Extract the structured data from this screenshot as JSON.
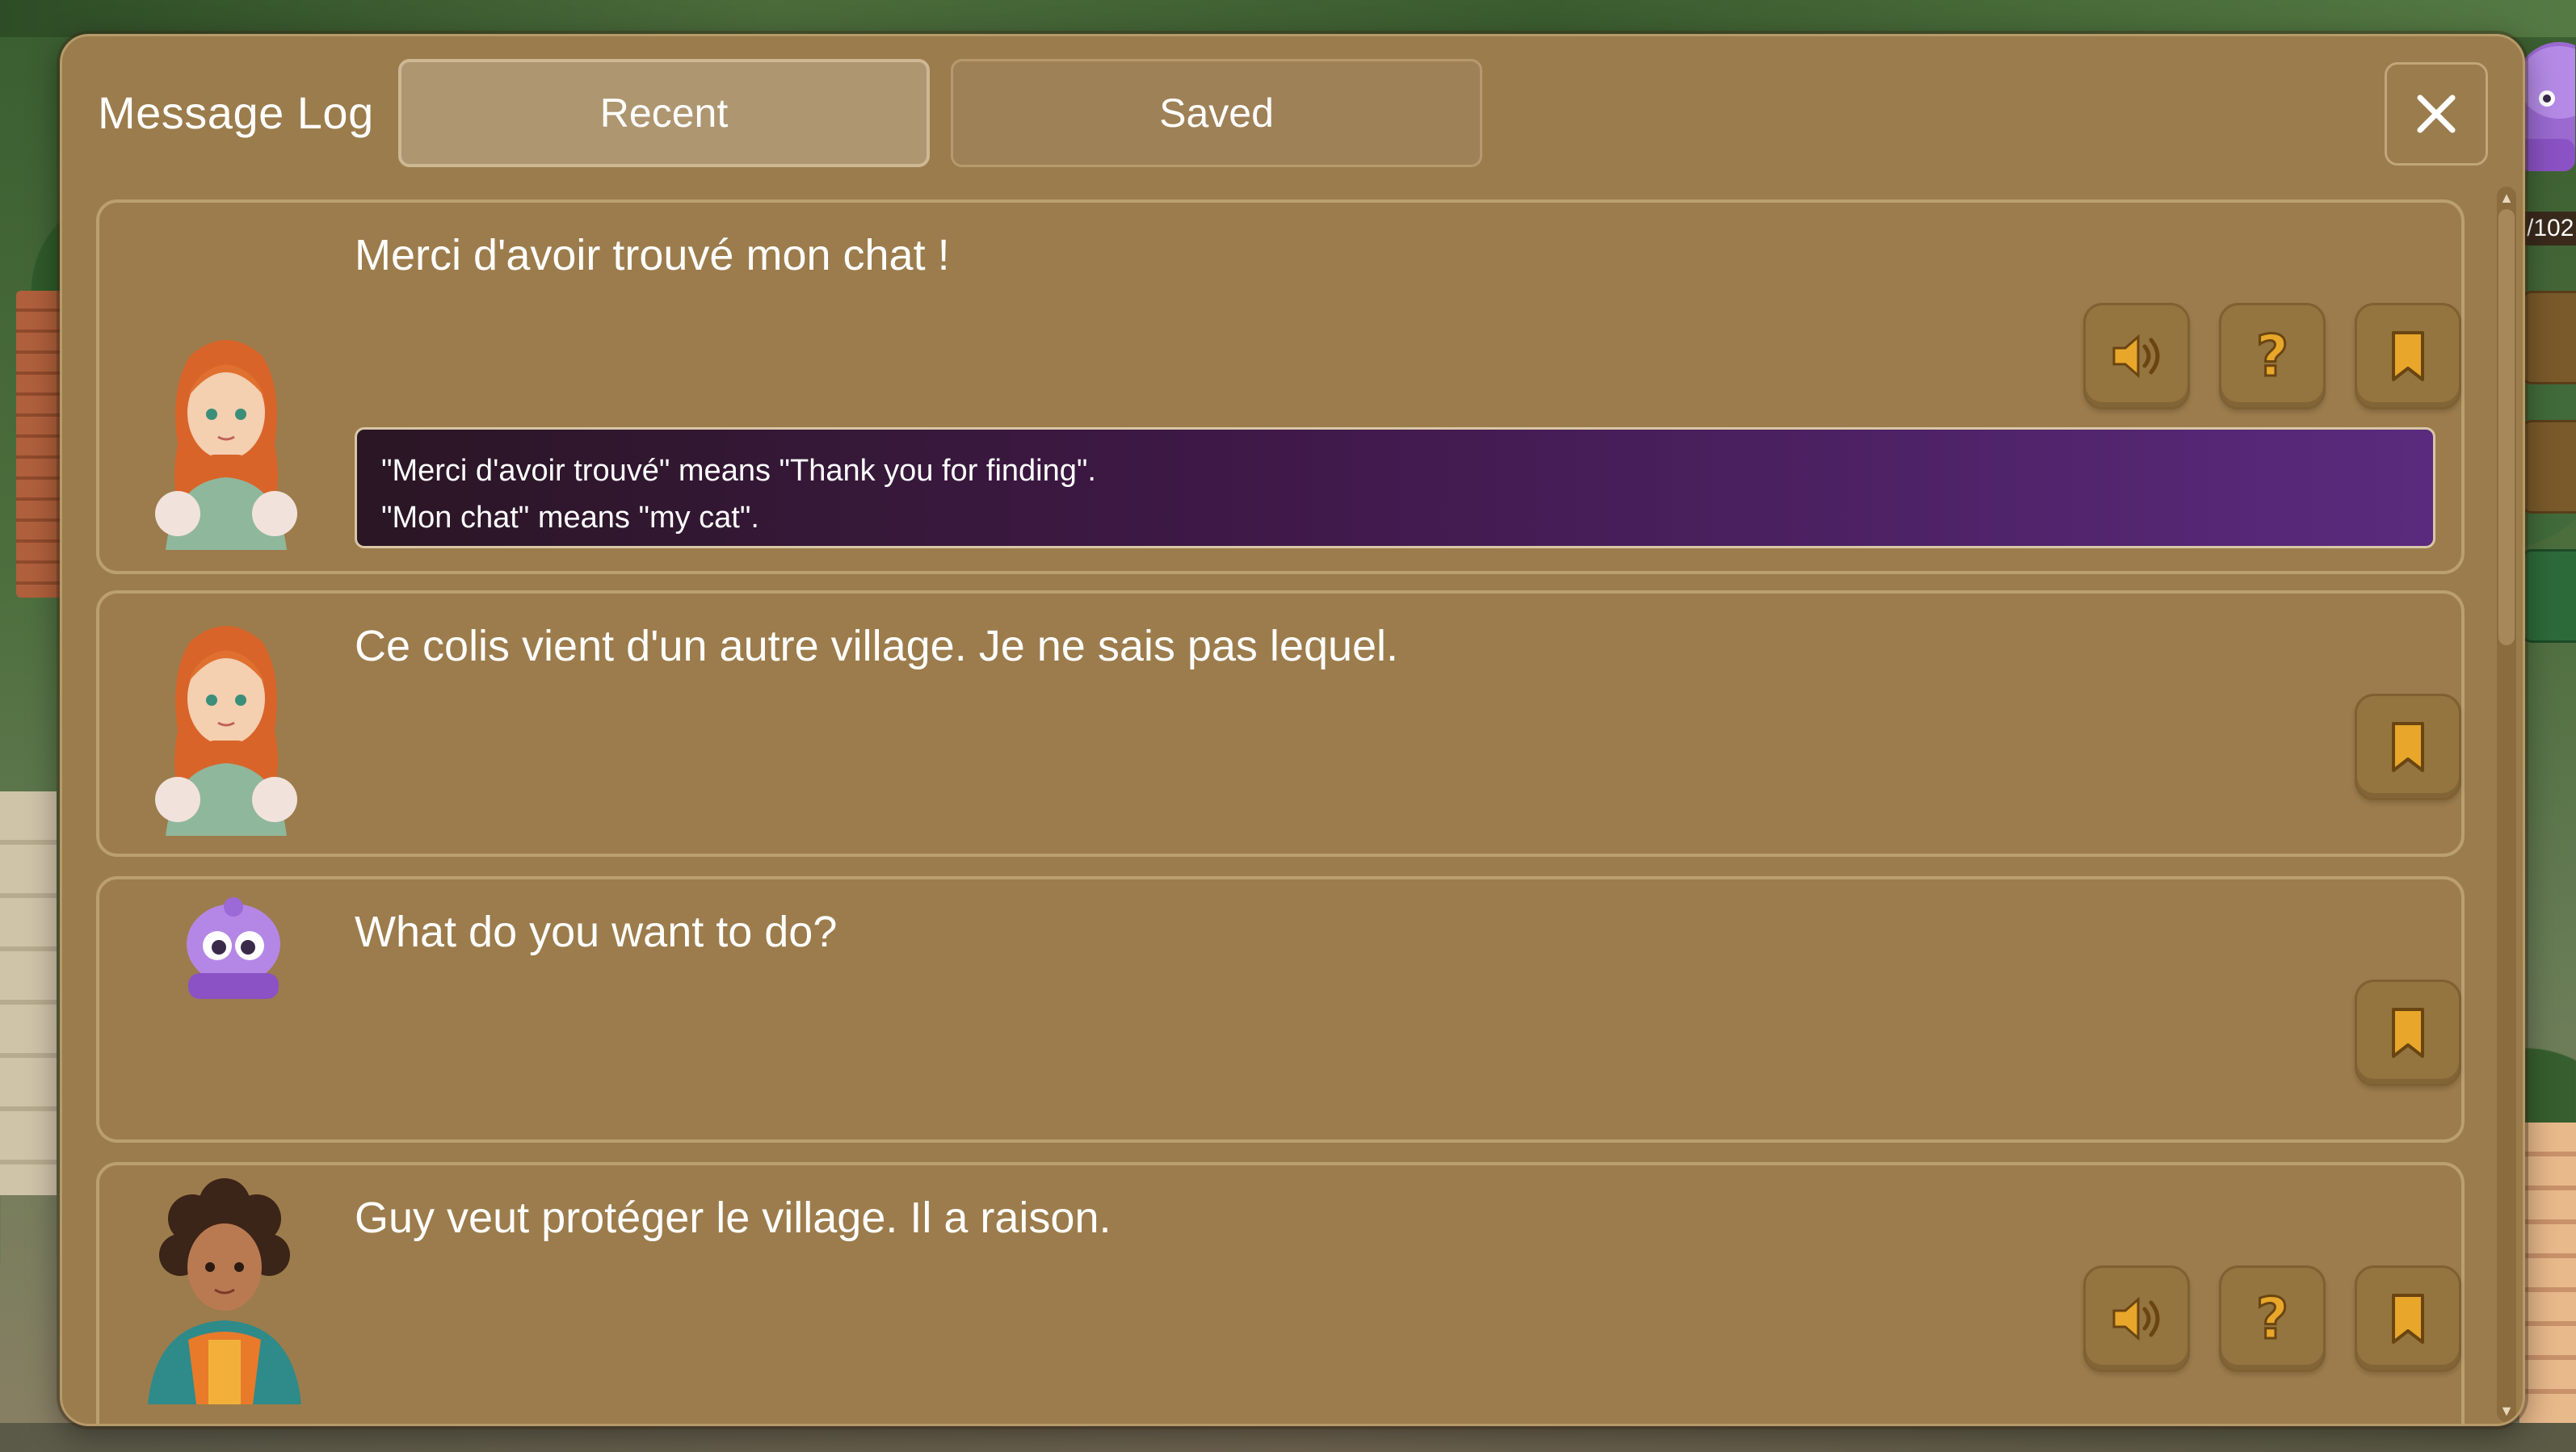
{
  "colors": {
    "panel": "#9b7c4c",
    "panel_border": "#bba06f",
    "button": "#94743f",
    "icon_gold": "#e8a72a",
    "translation_start": "#2a1624",
    "translation_end": "#5a2a7e"
  },
  "header": {
    "title": "Message Log",
    "tabs": [
      {
        "label": "Recent",
        "active": true
      },
      {
        "label": "Saved",
        "active": false
      }
    ],
    "close_icon": "close-icon"
  },
  "hud": {
    "counter": "/102"
  },
  "messages": [
    {
      "speaker_avatar": "redhead-girl-avatar",
      "text": "Merci d'avoir trouvé mon chat !",
      "actions": [
        "speaker-icon",
        "help-icon",
        "bookmark-icon"
      ],
      "translation": [
        "\"Merci d'avoir trouvé\" means \"Thank you for finding\".",
        "\"Mon chat\" means \"my cat\"."
      ]
    },
    {
      "speaker_avatar": "redhead-girl-avatar",
      "text": "Ce colis vient d'un autre village. Je ne sais pas lequel.",
      "actions": [
        "bookmark-icon"
      ]
    },
    {
      "speaker_avatar": "purple-blob-avatar",
      "text": "What do you want to do?",
      "actions": [
        "bookmark-icon"
      ]
    },
    {
      "speaker_avatar": "curly-hair-girl-avatar",
      "text": "Guy veut protéger le village. Il a raison.",
      "actions": [
        "speaker-icon",
        "help-icon",
        "bookmark-icon"
      ]
    }
  ]
}
